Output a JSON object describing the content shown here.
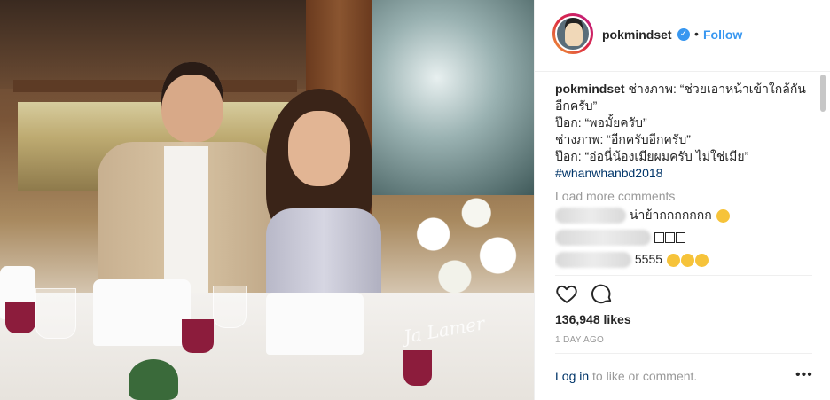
{
  "post": {
    "photo_watermark": "Ja Lamer",
    "user": {
      "username": "pokmindset",
      "verified_icon": "verified-badge-icon",
      "dot": "•",
      "follow_label": "Follow"
    },
    "caption": {
      "username": "pokmindset",
      "line1": "ช่างภาพ: “ช่วยเอาหน้าเข้าใกล้กันอีกครับ”",
      "line2": "ป๊อก: “พอมั้ยครับ”",
      "line3": "ช่างภาพ: “อีกครับอีกครับ”",
      "line4": "ป๊อก: “อ่อนี่น้องเมียผมครับ ไม่ใช่เมีย”",
      "hashtag": "#whanwhanbd2018"
    },
    "load_more": "Load more comments",
    "comments": [
      {
        "text": "น่าย้ากกกกกกก"
      },
      {
        "text": ""
      },
      {
        "text": "5555"
      }
    ],
    "likes": "136,948 likes",
    "time": "1 DAY AGO",
    "footer": {
      "login_link": "Log in",
      "login_rest": " to like or comment.",
      "more": "•••"
    },
    "colors": {
      "link_blue": "#3897f0",
      "hashtag_blue": "#003569",
      "muted": "#999999"
    }
  }
}
